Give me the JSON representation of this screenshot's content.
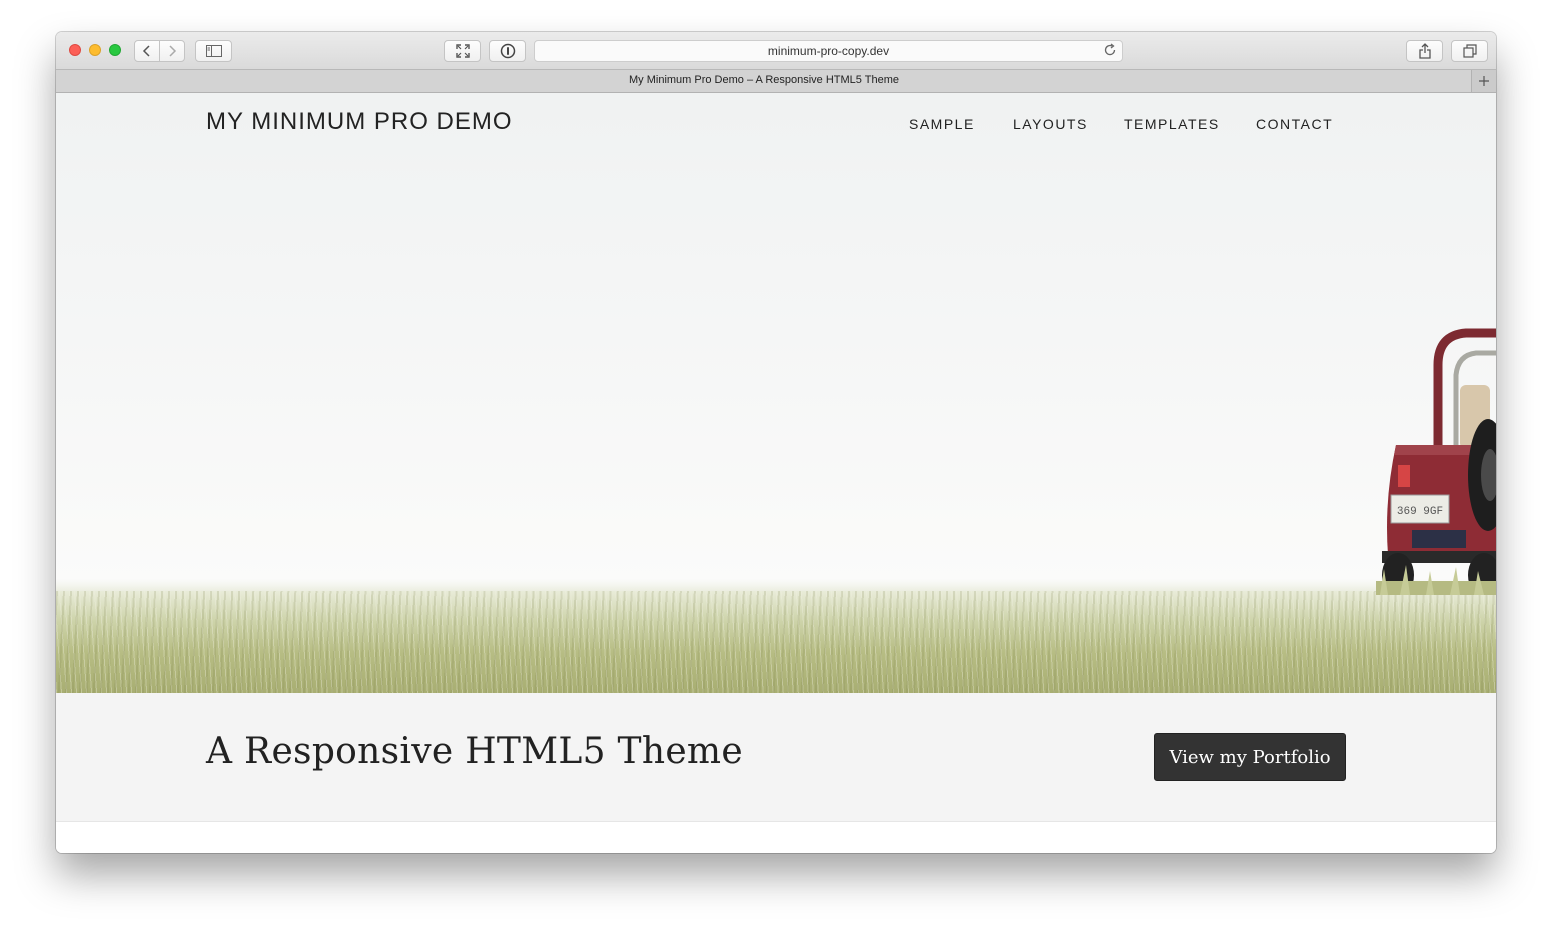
{
  "browser": {
    "url": "minimum-pro-copy.dev",
    "tab_title": "My Minimum Pro Demo – A Responsive HTML5 Theme",
    "icons": [
      "back-arrow-icon",
      "forward-arrow-icon",
      "sidebar-icon",
      "fullscreen-icon",
      "password-icon",
      "reload-icon",
      "share-icon",
      "tabs-overview-icon",
      "plus-icon"
    ]
  },
  "site": {
    "title": "MY MINIMUM PRO DEMO",
    "nav": [
      {
        "label": "SAMPLE"
      },
      {
        "label": "LAYOUTS"
      },
      {
        "label": "TEMPLATES"
      },
      {
        "label": "CONTACT"
      }
    ],
    "hero": {
      "plate_text": "369 9GF"
    },
    "tagline": "A Responsive HTML5 Theme",
    "cta_label": "View my Portfolio"
  },
  "colors": {
    "button_bg": "#333333",
    "band_bg": "#f4f4f4",
    "jeep_red": "#8e2c35",
    "close": "#fc5f57",
    "minimize": "#fdbc2e",
    "zoom": "#28c840"
  }
}
